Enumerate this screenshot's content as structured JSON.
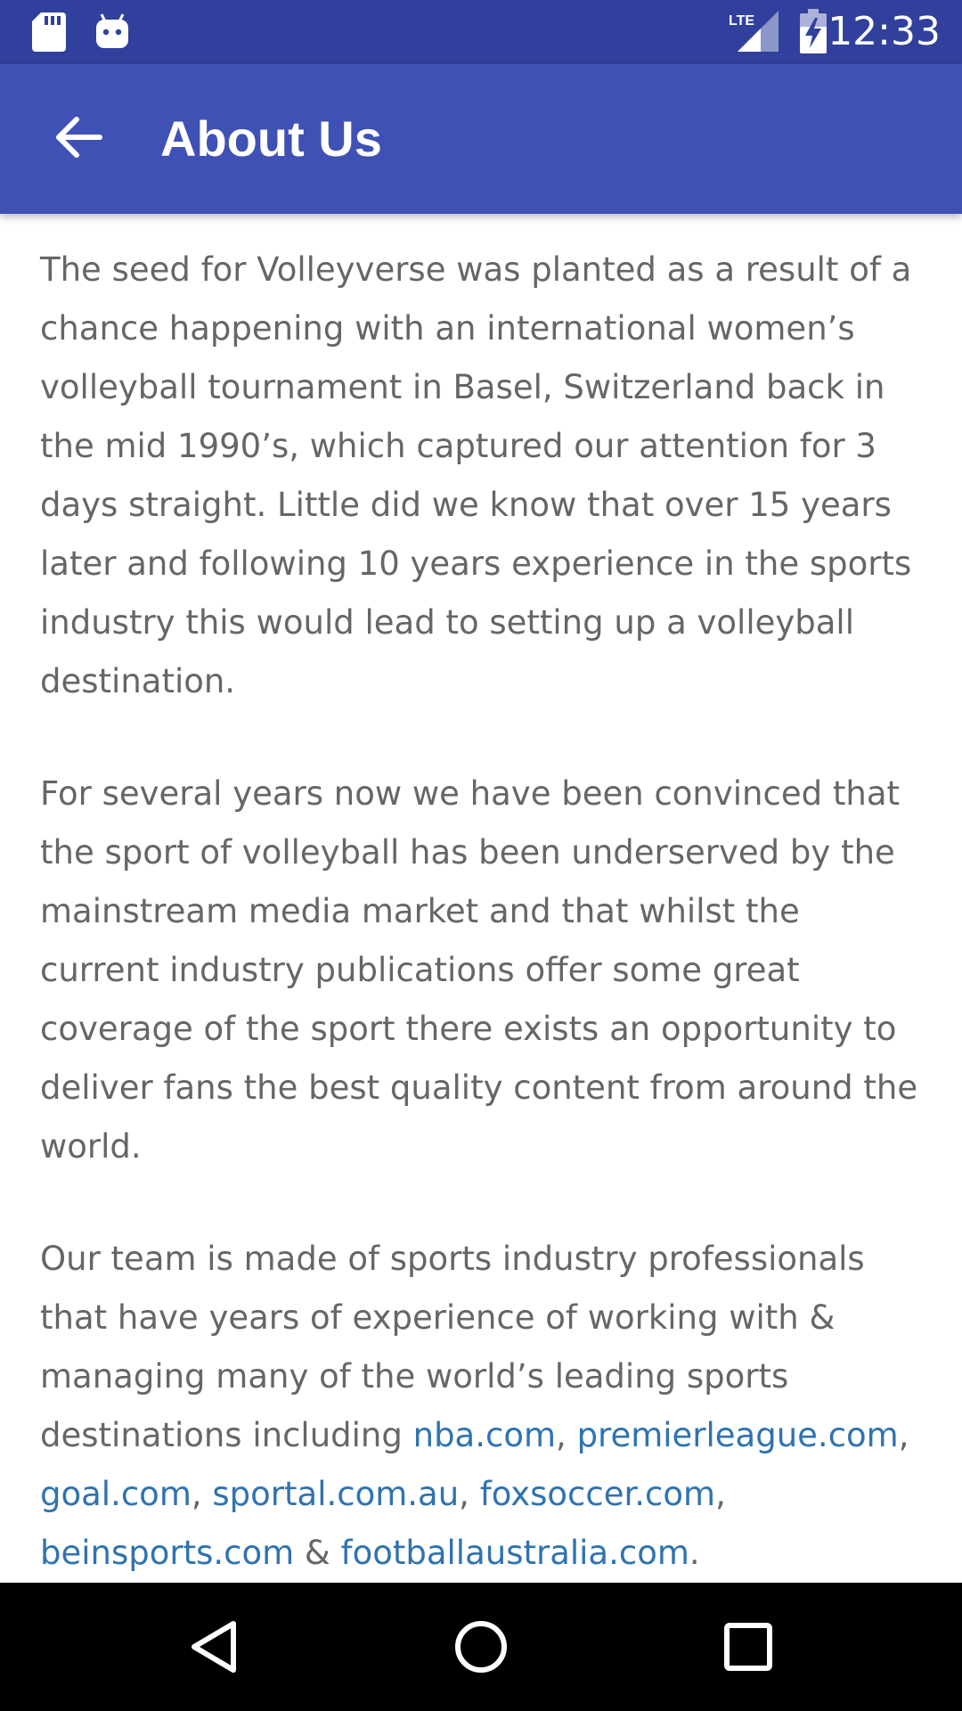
{
  "status_bar": {
    "time": "12:33",
    "network_label": "LTE",
    "icons": [
      "sd-card-icon",
      "android-debug-icon",
      "signal-icon",
      "battery-charging-icon"
    ]
  },
  "app_bar": {
    "title": "About Us",
    "back_icon": "arrow-back-icon",
    "background_color": "#3f51b5",
    "status_color": "#30409c"
  },
  "content": {
    "paragraph_1": "The seed for Volleyverse was planted as a result of a chance happening with an international women’s volleyball tournament in Basel, Switzerland back in the mid 1990’s, which captured our attention for 3 days straight. Little did we know that over 15 years later and following 10 years experience in the sports industry this would lead to setting up a volleyball destination.",
    "paragraph_2": "For several years now we have been convinced that the sport of volleyball has been underserved by the mainstream media market and that whilst the current industry publications offer some great coverage of the sport there exists an opportunity to deliver fans the best quality content from around the world.",
    "paragraph_3_intro": "Our team is made of sports industry professionals that have years of experience of working with & managing many of the world’s leading sports destinations including ",
    "links": {
      "nba": "nba.com",
      "premierleague": "premierleague.com",
      "goal": "goal.com",
      "sportal": "sportal.com.au",
      "foxsoccer": "foxsoccer.com",
      "beinsports": "beinsports.com",
      "footballaustralia": "footballaustralia.com"
    },
    "sep_comma": ", ",
    "sep_amp": " & ",
    "end_period": ".",
    "text_color": "#666666",
    "link_color": "#2f73b0"
  },
  "nav_bar": {
    "buttons": [
      "back-triangle-icon",
      "home-circle-icon",
      "recents-square-icon"
    ]
  }
}
